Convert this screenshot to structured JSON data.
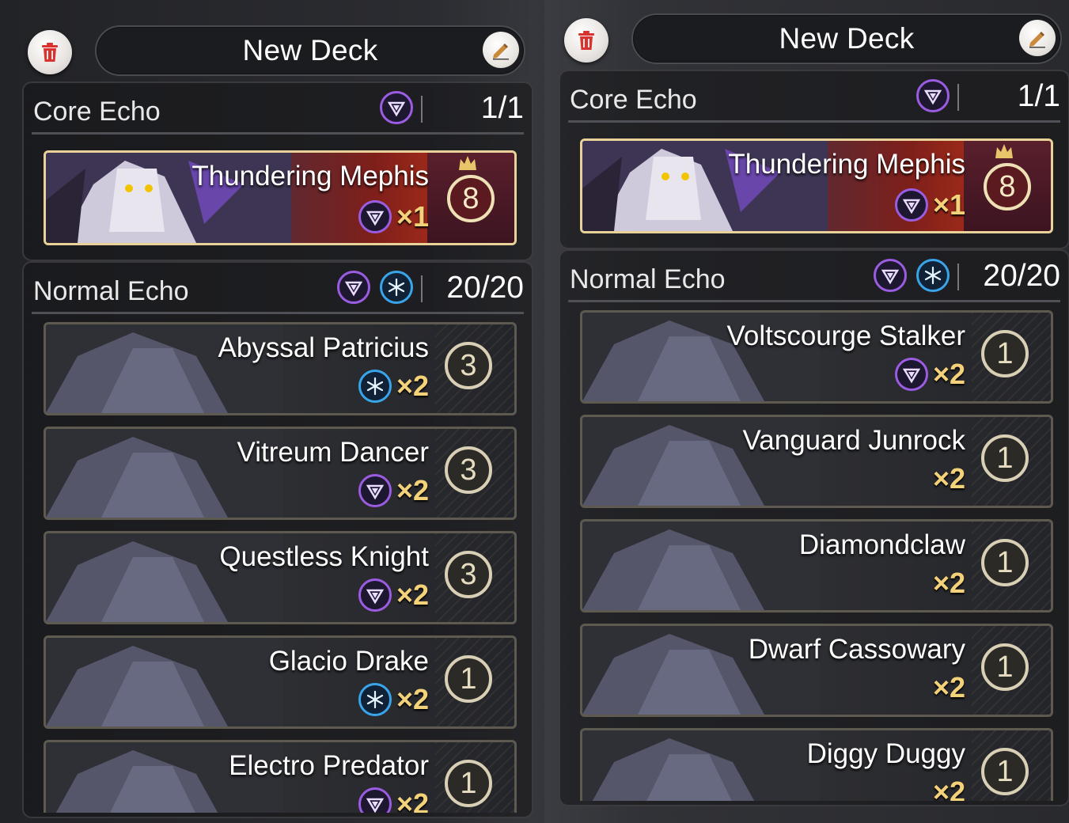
{
  "panels": [
    {
      "title": "New Deck",
      "core": {
        "label": "Core Echo",
        "count": "1/1",
        "elements": [
          "havoc"
        ],
        "card": {
          "name": "Thundering Mephis",
          "element": "havoc",
          "qty": "×1",
          "cost": "8"
        }
      },
      "normal": {
        "label": "Normal Echo",
        "count": "20/20",
        "elements": [
          "havoc",
          "glacio"
        ],
        "cards": [
          {
            "name": "Abyssal Patricius",
            "element": "glacio",
            "qty": "×2",
            "cost": "3"
          },
          {
            "name": "Vitreum Dancer",
            "element": "havoc",
            "qty": "×2",
            "cost": "3"
          },
          {
            "name": "Questless Knight",
            "element": "havoc",
            "qty": "×2",
            "cost": "3"
          },
          {
            "name": "Glacio Drake",
            "element": "glacio",
            "qty": "×2",
            "cost": "1"
          },
          {
            "name": "Electro Predator",
            "element": "havoc",
            "qty": "×2",
            "cost": "1"
          }
        ]
      }
    },
    {
      "title": "New Deck",
      "core": {
        "label": "Core Echo",
        "count": "1/1",
        "elements": [
          "havoc"
        ],
        "card": {
          "name": "Thundering Mephis",
          "element": "havoc",
          "qty": "×1",
          "cost": "8"
        }
      },
      "normal": {
        "label": "Normal Echo",
        "count": "20/20",
        "elements": [
          "havoc",
          "glacio"
        ],
        "cards": [
          {
            "name": "Voltscourge Stalker",
            "element": "havoc",
            "qty": "×2",
            "cost": "1"
          },
          {
            "name": "Vanguard Junrock",
            "element": "",
            "qty": "×2",
            "cost": "1"
          },
          {
            "name": "Diamondclaw",
            "element": "",
            "qty": "×2",
            "cost": "1"
          },
          {
            "name": "Dwarf Cassowary",
            "element": "",
            "qty": "×2",
            "cost": "1"
          },
          {
            "name": "Diggy Duggy",
            "element": "",
            "qty": "×2",
            "cost": "1"
          }
        ]
      }
    }
  ],
  "colors": {
    "havoc": "#9a5ce0",
    "glacio": "#3aa4e8",
    "qty": "#f4d27a",
    "trash": "#d9332f"
  },
  "icons": {
    "delete": "trash-icon",
    "rename": "pencil-icon",
    "havoc": "havoc-element-icon",
    "glacio": "glacio-element-icon"
  }
}
